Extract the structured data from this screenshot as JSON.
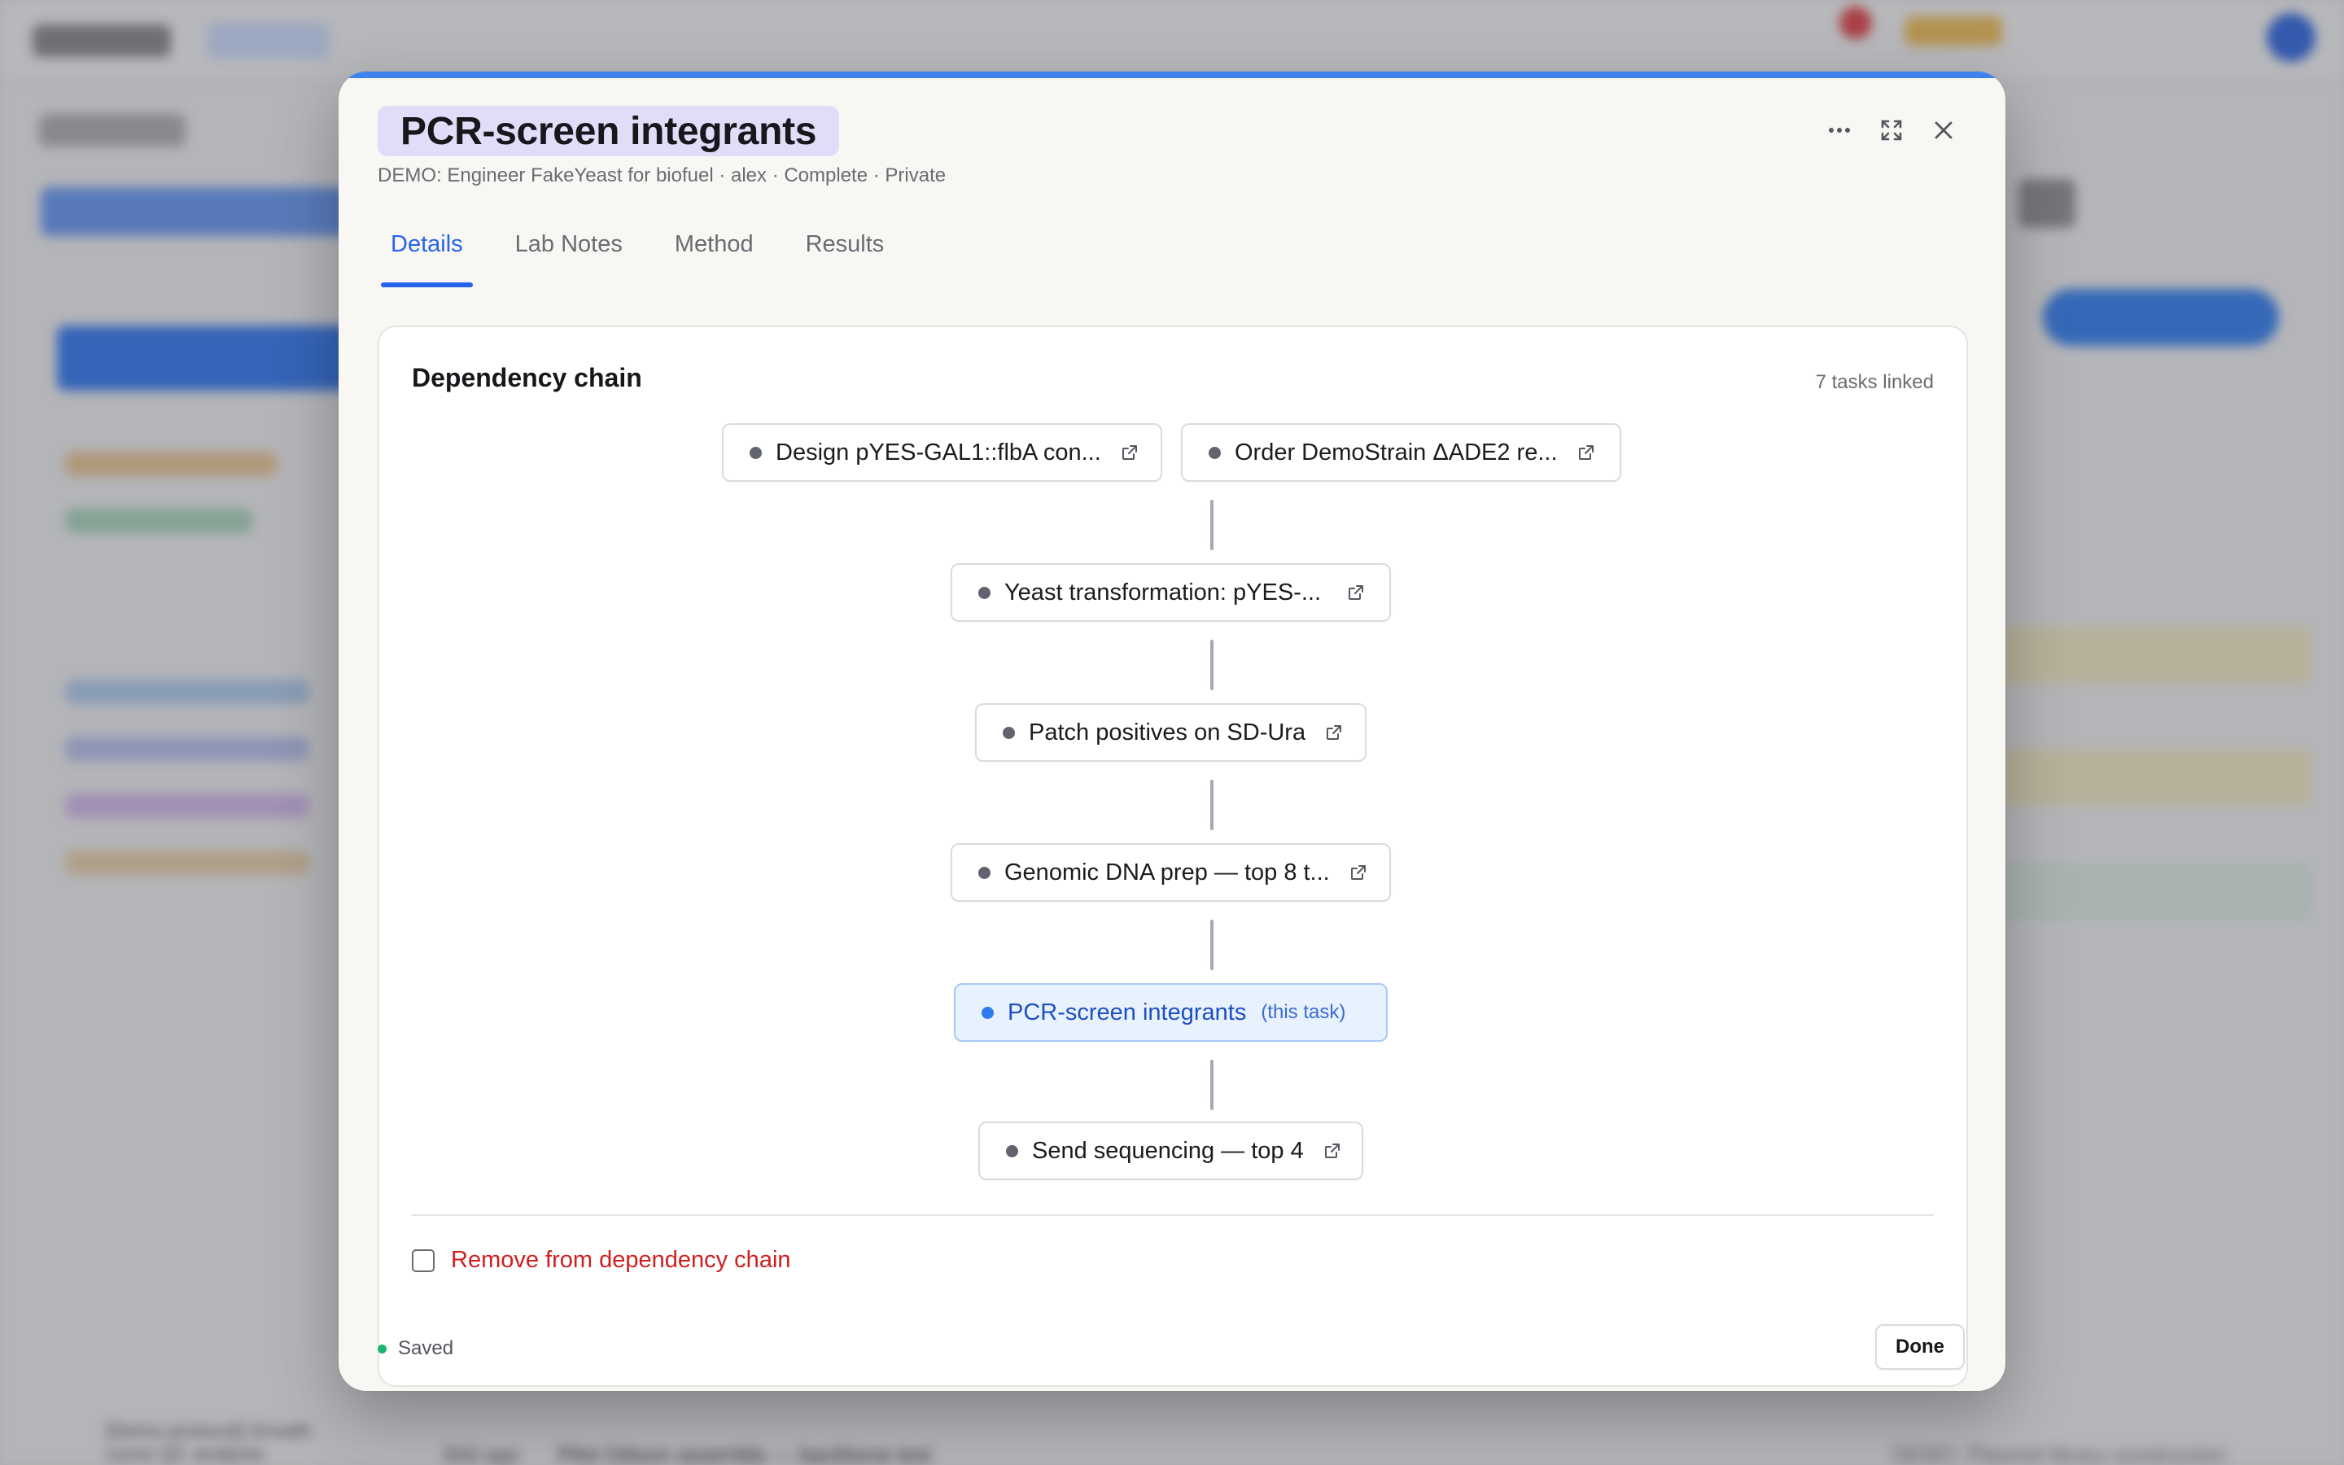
{
  "background": {
    "rows": [
      {
        "age": "84d ago",
        "title": "Pilot Gibson assembly — backbone test",
        "project": "DEMO: Plasmid library construction"
      }
    ],
    "sidebar_snippet": "[Demo protocol] Growth curve QC analysis"
  },
  "modal": {
    "title": "PCR-screen integrants",
    "subtitle": "DEMO: Engineer FakeYeast for biofuel · alex · Complete · Private",
    "header_icons": [
      "more-icon",
      "expand-icon",
      "close-icon"
    ],
    "tabs": [
      {
        "label": "Details",
        "active": true
      },
      {
        "label": "Lab Notes",
        "active": false
      },
      {
        "label": "Method",
        "active": false
      },
      {
        "label": "Results",
        "active": false
      }
    ],
    "dependency": {
      "title": "Dependency chain",
      "count_label": "7 tasks linked",
      "nodes": [
        {
          "label": "Design pYES-GAL1::flbA con..."
        },
        {
          "label": "Order DemoStrain ΔADE2 re..."
        },
        {
          "label": "Yeast transformation: pYES-..."
        },
        {
          "label": "Patch positives on SD-Ura"
        },
        {
          "label": "Genomic DNA prep — top 8 t..."
        },
        {
          "label": "PCR-screen integrants",
          "tag": "(this task)",
          "current": true
        },
        {
          "label": "Send sequencing — top 4"
        }
      ],
      "remove_label": "Remove from dependency chain",
      "remove_checked": false
    },
    "footer": {
      "status": "Saved",
      "status_color": "#1bb56b",
      "done_label": "Done"
    },
    "accent_color": "#3e82ee"
  }
}
